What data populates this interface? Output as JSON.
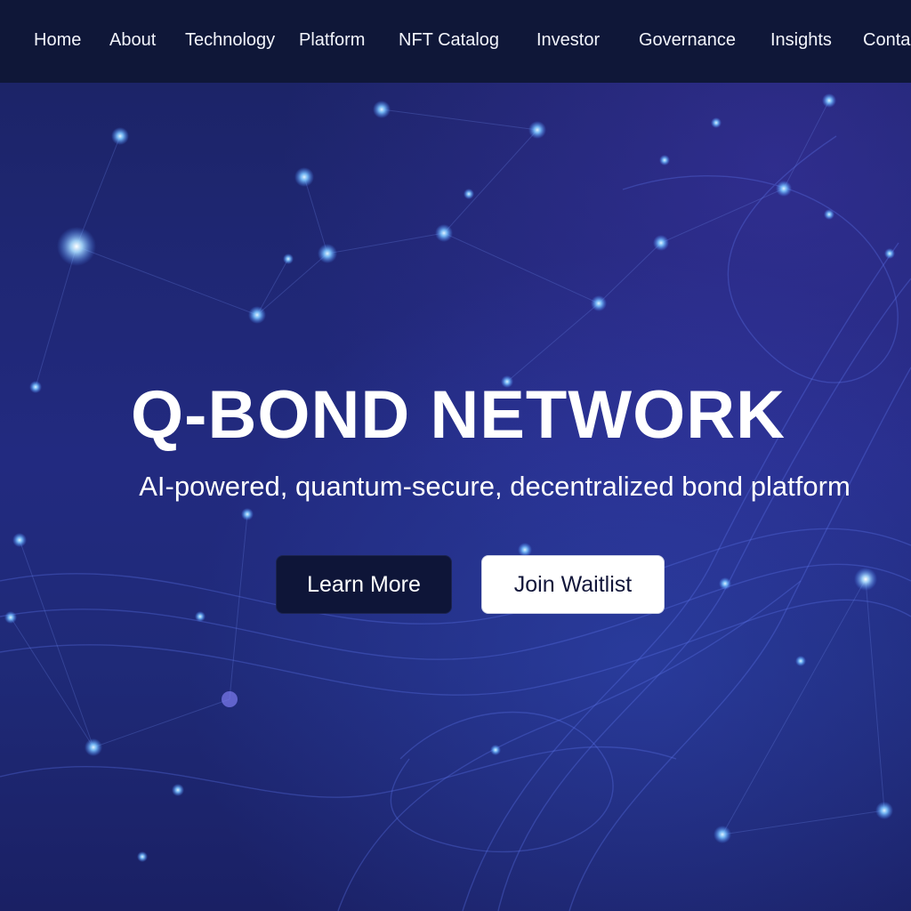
{
  "nav": {
    "items": [
      {
        "label": "Home"
      },
      {
        "label": "About"
      },
      {
        "label": "Technology"
      },
      {
        "label": "Platform"
      },
      {
        "label": "NFT Catalog"
      },
      {
        "label": "Investor"
      },
      {
        "label": "Governance"
      },
      {
        "label": "Insights"
      },
      {
        "label": "Conta"
      }
    ]
  },
  "hero": {
    "title": "Q-BOND NETWORK",
    "subtitle": "AI-powered, quantum-secure, decentralized bond platform",
    "primary_button": "Learn More",
    "secondary_button": "Join Waitlist"
  },
  "colors": {
    "nav_background": "#0f1738",
    "hero_background": "#222a80",
    "node_glow": "#5fb4ff",
    "primary_button": "#0e1538",
    "secondary_button": "#ffffff"
  }
}
